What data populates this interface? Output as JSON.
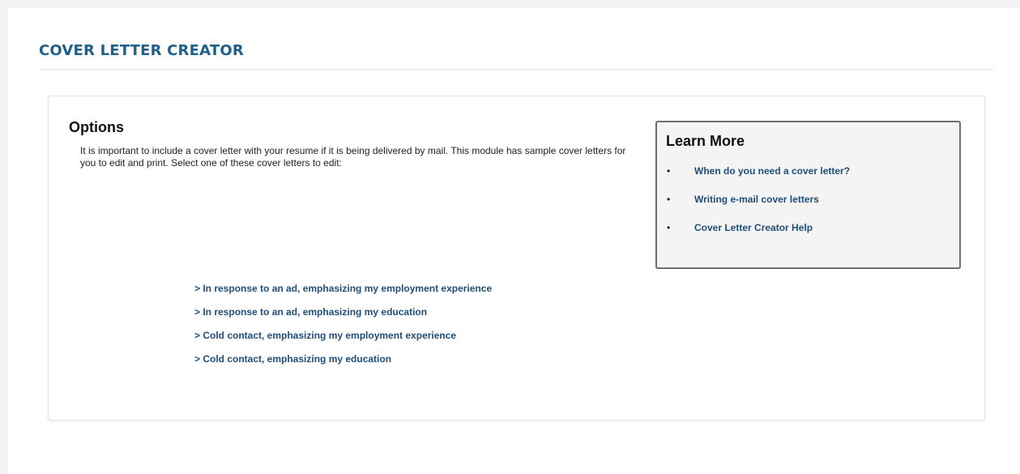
{
  "page": {
    "title": "COVER LETTER CREATOR"
  },
  "options": {
    "heading": "Options",
    "intro": "It is important to include a cover letter with your resume if it is being delivered by mail. This module has sample cover letters for you to edit and print. Select one of these cover letters to edit:",
    "letters": [
      {
        "label": "> In response to an ad, emphasizing my employment experience"
      },
      {
        "label": "> In response to an ad, emphasizing my education"
      },
      {
        "label": "> Cold contact, emphasizing my employment experience"
      },
      {
        "label": "> Cold contact, emphasizing my education"
      }
    ]
  },
  "learn_more": {
    "heading": "Learn More",
    "bullet": "•",
    "links": [
      {
        "label": "When do you need a cover letter?"
      },
      {
        "label": "Writing e-mail cover letters"
      },
      {
        "label": "Cover Letter Creator Help"
      }
    ]
  },
  "colors": {
    "title": "#1f5f8b",
    "link": "#1f4e7a",
    "learn_box_bg": "#f4f4f4",
    "learn_box_border": "#6f6f6f"
  }
}
